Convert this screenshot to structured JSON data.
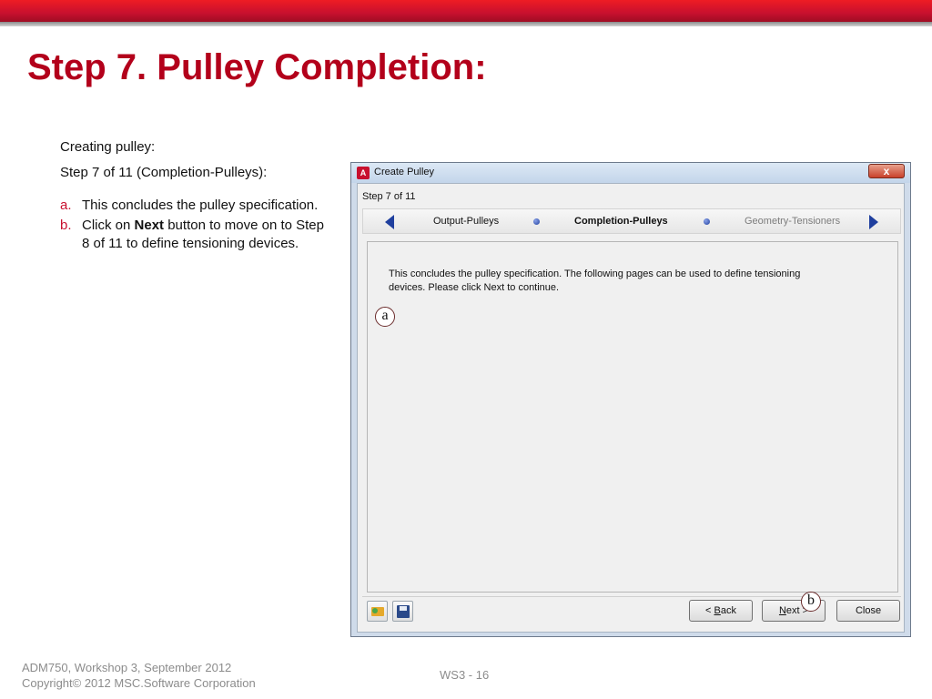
{
  "slide": {
    "title": "Step 7.  Pulley Completion:",
    "accent_color": "#b3001b"
  },
  "instructions": {
    "line1": "Creating pulley:",
    "line2": "Step 7 of 11 (Completion-Pulleys):",
    "items": [
      {
        "marker": "a.",
        "text": "This concludes the pulley specification."
      },
      {
        "marker": "b.",
        "pre": "Click on ",
        "bold": "Next",
        "post": " button to move on to Step 8 of 11 to  define tensioning devices."
      }
    ]
  },
  "dialog": {
    "app_icon_letter": "A",
    "title": "Create Pulley",
    "close_label": "x",
    "step_label": "Step 7 of 11",
    "nav": {
      "prev": "Output-Pulleys",
      "current": "Completion-Pulleys",
      "next": "Geometry-Tensioners"
    },
    "message_line1": "This concludes the pulley specification. The following pages can be used to define tensioning",
    "message_line2": "devices. Please click Next to continue.",
    "buttons": {
      "back_prefix": "< ",
      "back_mnemonic": "B",
      "back_rest": "ack",
      "next_mnemonic": "N",
      "next_rest": "ext >",
      "close": "Close"
    }
  },
  "callouts": {
    "a": "a",
    "b": "b"
  },
  "footer": {
    "line1": "ADM750, Workshop 3, September 2012",
    "line2": "Copyright© 2012 MSC.Software Corporation",
    "page": "WS3 - 16"
  },
  "icons": [
    "app-icon",
    "close-icon",
    "left-arrow-icon",
    "right-arrow-icon",
    "open-folder-icon",
    "save-disk-icon"
  ]
}
